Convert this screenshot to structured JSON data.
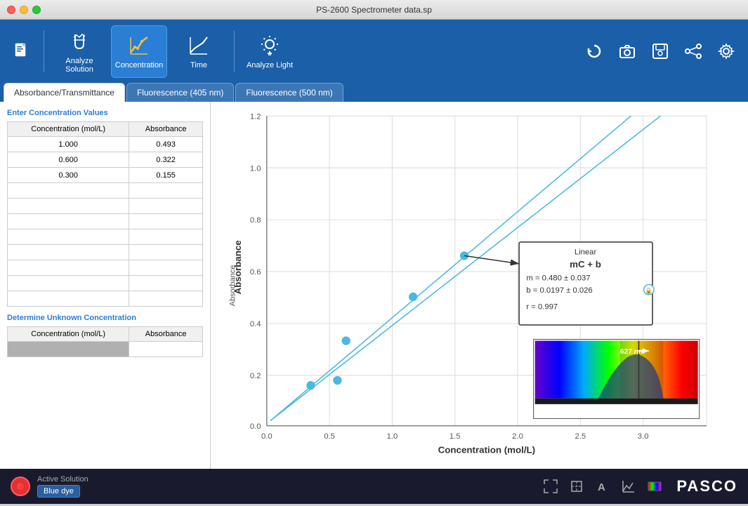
{
  "window": {
    "title": "PS-2600 Spectrometer data.sp"
  },
  "toolbar": {
    "new_btn_label": "New",
    "buttons": [
      {
        "id": "analyze-solution",
        "label": "Analyze Solution",
        "active": false
      },
      {
        "id": "concentration",
        "label": "Concentration",
        "active": true
      },
      {
        "id": "time",
        "label": "Time",
        "active": false
      },
      {
        "id": "analyze-light",
        "label": "Analyze Light",
        "active": false
      }
    ],
    "right_icons": [
      "refresh",
      "camera",
      "save-camera",
      "share",
      "settings"
    ]
  },
  "tabs": [
    {
      "id": "absorbance",
      "label": "Absorbance/Transmittance",
      "active": true
    },
    {
      "id": "fluorescence-405",
      "label": "Fluorescence (405 nm)",
      "active": false
    },
    {
      "id": "fluorescence-500",
      "label": "Fluorescence (500 nm)",
      "active": false
    }
  ],
  "left_panel": {
    "concentration_section": {
      "title": "Enter Concentration Values",
      "columns": [
        "Concentration (mol/L)",
        "Absorbance"
      ],
      "rows": [
        {
          "concentration": "1.000",
          "absorbance": "0.493"
        },
        {
          "concentration": "0.600",
          "absorbance": "0.322"
        },
        {
          "concentration": "0.300",
          "absorbance": "0.155"
        },
        {
          "concentration": "",
          "absorbance": ""
        },
        {
          "concentration": "",
          "absorbance": ""
        },
        {
          "concentration": "",
          "absorbance": ""
        },
        {
          "concentration": "",
          "absorbance": ""
        },
        {
          "concentration": "",
          "absorbance": ""
        },
        {
          "concentration": "",
          "absorbance": ""
        },
        {
          "concentration": "",
          "absorbance": ""
        },
        {
          "concentration": "",
          "absorbance": ""
        }
      ]
    },
    "unknown_section": {
      "title": "Determine Unknown Concentration",
      "columns": [
        "Concentration (mol/L)",
        "Absorbance"
      ],
      "rows": [
        {
          "concentration": "gray",
          "absorbance": ""
        }
      ]
    }
  },
  "chart": {
    "x_label": "Concentration (mol/L)",
    "y_label": "Absorbance",
    "x_min": 0,
    "x_max": 3.0,
    "y_min": 0,
    "y_max": 1.2,
    "x_ticks": [
      "0.0",
      "0.5",
      "1.0",
      "1.5",
      "2.0",
      "2.5",
      "3.0"
    ],
    "y_ticks": [
      "0.0",
      "0.2",
      "0.4",
      "0.6",
      "0.8",
      "1.0",
      "1.2"
    ],
    "data_points": [
      {
        "x": 0.3,
        "y": 0.155
      },
      {
        "x": 0.48,
        "y": 0.175
      },
      {
        "x": 0.54,
        "y": 0.33
      },
      {
        "x": 1.0,
        "y": 0.5
      },
      {
        "x": 1.35,
        "y": 0.66
      }
    ],
    "line_start": {
      "x": 0,
      "y": 0.0197
    },
    "line_end": {
      "x": 3.0,
      "y": 1.46
    },
    "info_box": {
      "title": "Linear",
      "equation": "mC + b",
      "m_value": "m = 0.480  ±  0.037",
      "b_value": "b = 0.0197 ± 0.026",
      "r_value": "r = 0.997"
    }
  },
  "spectrum": {
    "wavelength_label": "627 nm"
  },
  "statusbar": {
    "active_label": "Active Solution",
    "solution_name": "Blue dye",
    "icons": [
      "expand",
      "crop",
      "text",
      "graph",
      "color"
    ]
  },
  "pasco": "PASCO"
}
